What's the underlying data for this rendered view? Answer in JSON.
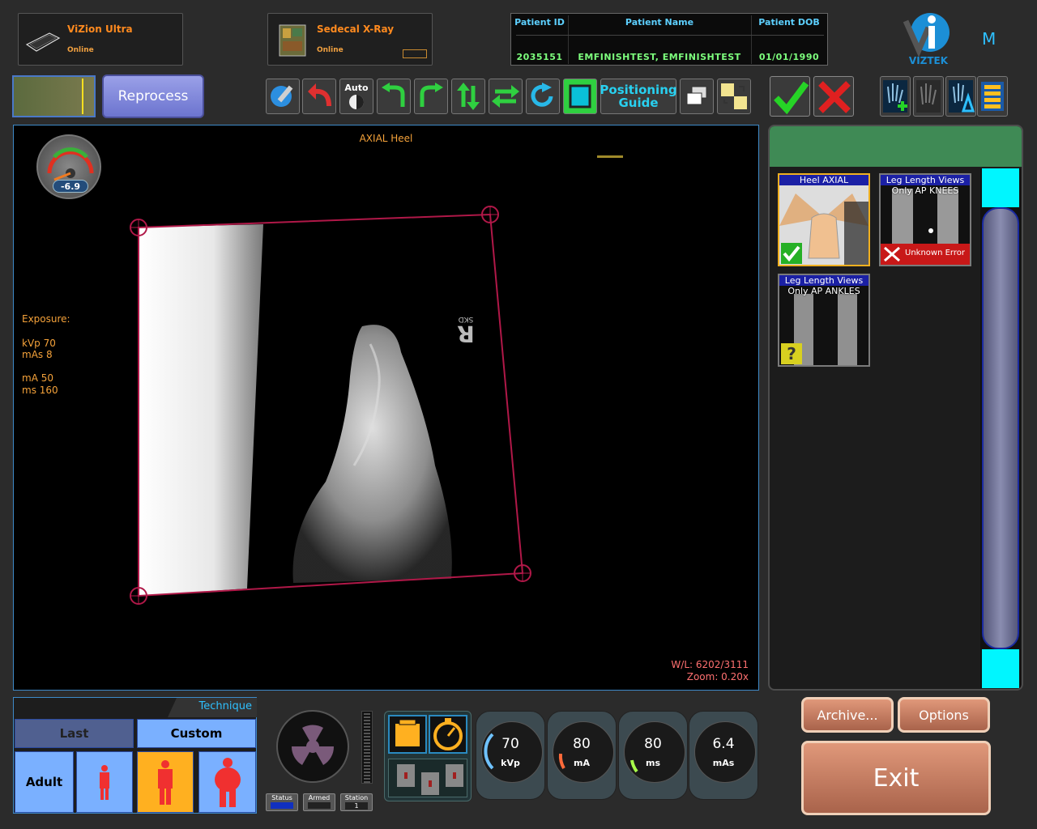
{
  "devices": [
    {
      "name": "ViZion Ultra",
      "status": "Online"
    },
    {
      "name": "Sedecal X-Ray",
      "status": "Online"
    }
  ],
  "patient": {
    "headers": [
      "Patient ID",
      "Patient Name",
      "Patient DOB"
    ],
    "id": "2035151",
    "name": "EMFINISHTEST, EMFINISHTEST",
    "dob": "01/01/1990"
  },
  "brand": {
    "logo_text": "VIZTEK",
    "mode_letter": "M"
  },
  "toolbar": {
    "reprocess_label": "Reprocess",
    "auto_label": "Auto",
    "positioning_label_1": "Positioning",
    "positioning_label_2": "Guide"
  },
  "viewer": {
    "title": "AXIAL Heel",
    "gauge_value": "-6.9",
    "marker_text": "R",
    "marker_sub": "SKD",
    "exposure_title": "Exposure:",
    "kvp_line": "kVp 70",
    "mas_line": "mAs 8",
    "ma_line": "mA 50",
    "ms_line": "ms 160",
    "wl_line": "W/L: 6202/3111",
    "zoom_line": "Zoom: 0.20x"
  },
  "thumbnails": [
    {
      "line1": "Heel AXIAL",
      "line2": "",
      "status": "Completed",
      "status_icon": "check-icon"
    },
    {
      "line1": "Leg Length Views",
      "line2": "Only AP KNEES",
      "status": "Unknown Error",
      "status_icon": "x-icon"
    },
    {
      "line1": "Leg Length Views",
      "line2": "Only AP ANKLES",
      "status": "",
      "status_icon": "question-icon"
    }
  ],
  "technique": {
    "tab_label": "Technique",
    "last_label": "Last",
    "custom_label": "Custom",
    "age_label": "Adult",
    "status_labels": [
      "Status",
      "Armed",
      "Station"
    ],
    "station_value": "1"
  },
  "dials": [
    {
      "value": "70",
      "unit": "kVp",
      "color": "#6fc2ff"
    },
    {
      "value": "80",
      "unit": "mA",
      "color": "#ff6a3a"
    },
    {
      "value": "80",
      "unit": "ms",
      "color": "#a8ff4a"
    },
    {
      "value": "6.4",
      "unit": "mAs",
      "color": "#cfcfcf"
    }
  ],
  "buttons": {
    "archive": "Archive...",
    "options": "Options",
    "exit": "Exit"
  },
  "colors": {
    "accent_orange": "#ff8a1f",
    "panel_green": "#3f8a55",
    "cyan": "#00f6ff"
  }
}
